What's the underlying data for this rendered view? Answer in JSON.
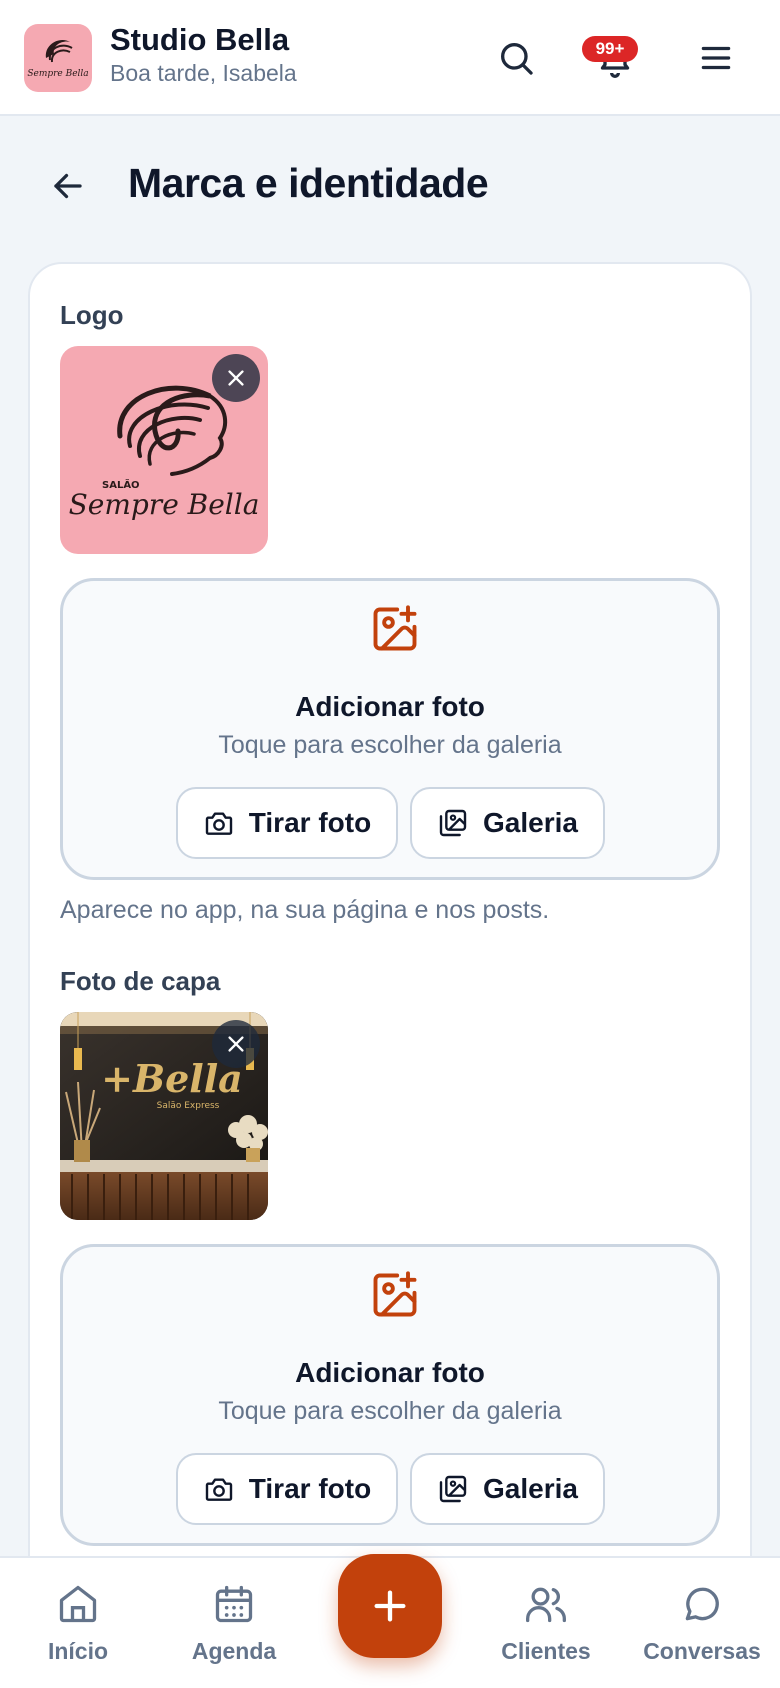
{
  "header": {
    "brand_name": "Studio Bella",
    "greeting": "Boa tarde, Isabela",
    "notification_count": "99+",
    "logo_text": "Sempre Bella"
  },
  "page": {
    "title": "Marca e identidade"
  },
  "logo_section": {
    "label": "Logo",
    "image_text_small": "SALÃO",
    "image_text_script": "Sempre Bella",
    "help_text": "Aparece no app, na sua página e nos posts."
  },
  "cover_section": {
    "label": "Foto de capa",
    "image_text_script": "+Bella",
    "image_text_sub": "Salão Express"
  },
  "dropzone": {
    "title": "Adicionar foto",
    "hint": "Toque para escolher da galeria",
    "camera_label": "Tirar foto",
    "gallery_label": "Galeria"
  },
  "bottom_nav": {
    "items": [
      {
        "label": "Início",
        "icon": "home-icon"
      },
      {
        "label": "Agenda",
        "icon": "calendar-icon"
      },
      {
        "label": "Clientes",
        "icon": "users-icon"
      },
      {
        "label": "Conversas",
        "icon": "chat-icon"
      }
    ],
    "fab_icon": "plus-icon"
  },
  "colors": {
    "accent": "#c2410c",
    "badge": "#dc2626",
    "logo_bg": "#f5a9b2"
  }
}
